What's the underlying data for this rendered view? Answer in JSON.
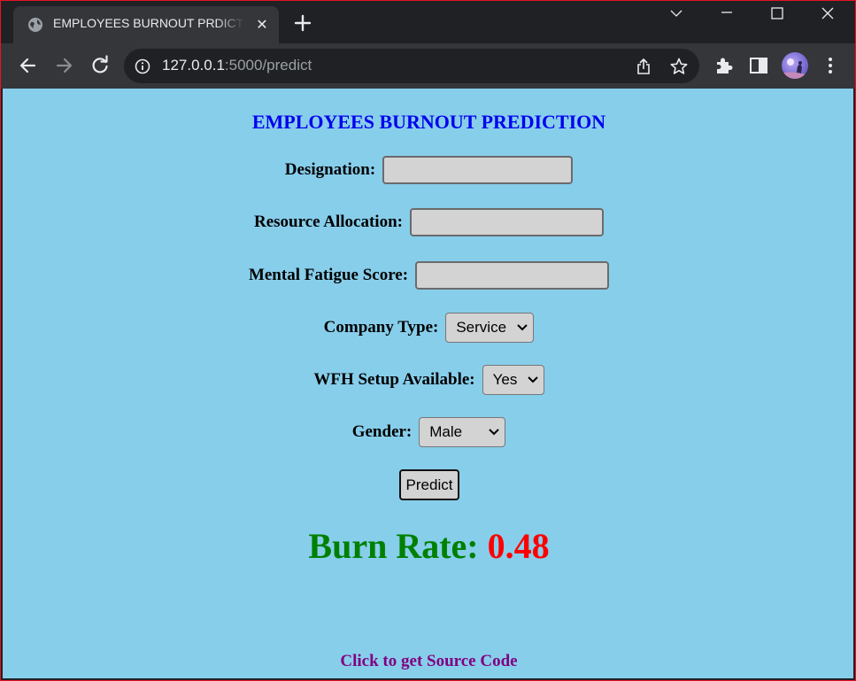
{
  "browser": {
    "tab": {
      "title": "EMPLOYEES BURNOUT PRDICTION",
      "favicon": "globe-icon",
      "close_icon": "close-icon"
    },
    "new_tab_icon": "plus-icon",
    "window_controls": [
      "chevron-down-icon",
      "minimize-icon",
      "maximize-icon",
      "close-icon"
    ],
    "toolbar": {
      "back_icon": "back-arrow-icon",
      "forward_icon": "forward-arrow-icon",
      "reload_icon": "reload-icon",
      "site_info_icon": "info-icon",
      "url_host": "127.0.0.1",
      "url_rest": ":5000/predict",
      "share_icon": "share-icon",
      "bookmark_icon": "star-icon",
      "extensions_icon": "puzzle-icon",
      "side_panel_icon": "side-panel-icon",
      "menu_icon": "kebab-menu-icon"
    }
  },
  "page": {
    "background": "#87ceeb",
    "heading": "EMPLOYEES BURNOUT PREDICTION",
    "fields": {
      "designation": {
        "label": "Designation:",
        "value": ""
      },
      "resource_allocation": {
        "label": "Resource Allocation:",
        "value": ""
      },
      "mental_fatigue": {
        "label": "Mental Fatigue Score:",
        "value": ""
      },
      "company_type": {
        "label": "Company Type:",
        "selected": "Service"
      },
      "wfh_setup": {
        "label": "WFH Setup Available:",
        "selected": "Yes"
      },
      "gender": {
        "label": "Gender:",
        "selected": "Male"
      }
    },
    "predict_button": "Predict",
    "result": {
      "label": "Burn Rate:",
      "value": "0.48",
      "label_color": "#008000",
      "value_color": "#ff0000"
    },
    "source_link": "Click to get Source Code"
  }
}
